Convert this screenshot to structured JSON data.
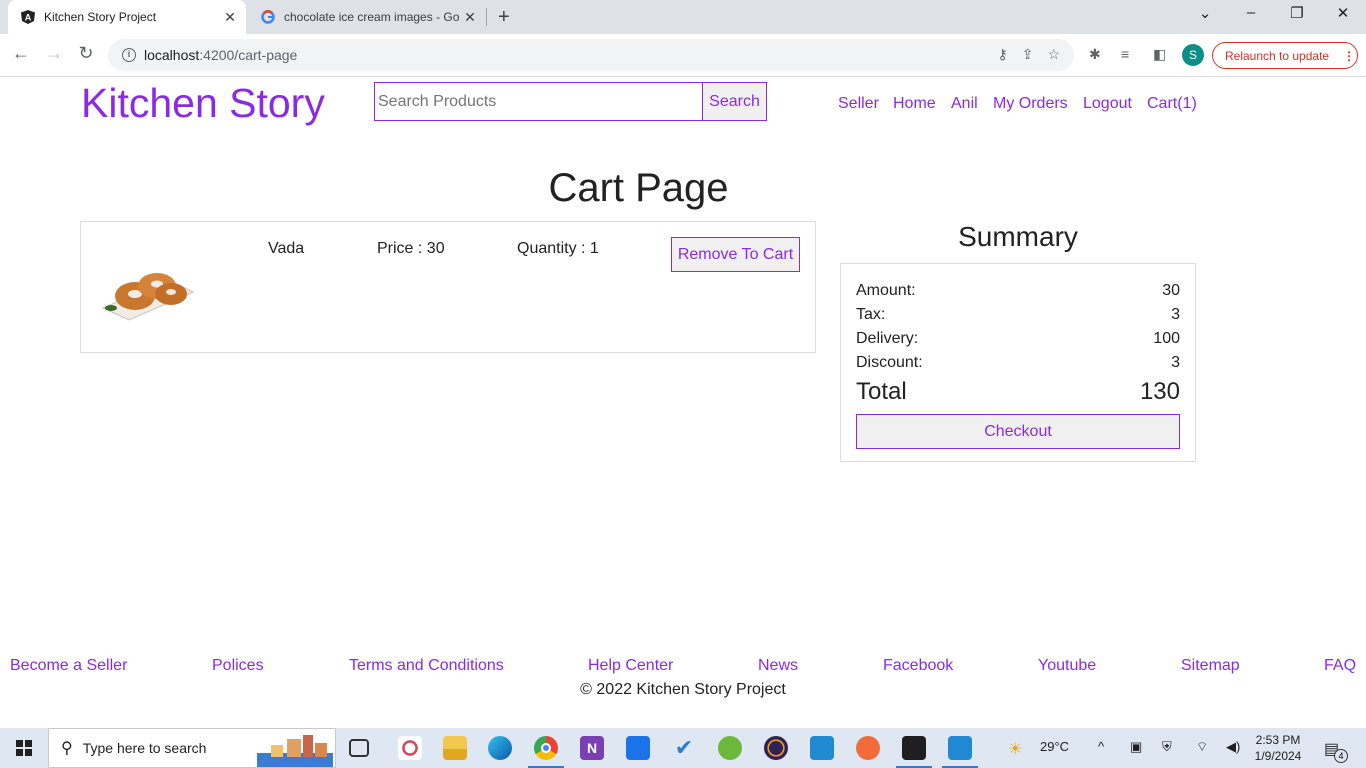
{
  "browser": {
    "tabs": [
      {
        "title": "Kitchen Story Project",
        "icon": "angular-icon"
      },
      {
        "title": "chocolate ice cream images - Go",
        "icon": "google-icon"
      }
    ],
    "url_host": "localhost",
    "url_path": ":4200/cart-page",
    "relaunch_label": "Relaunch to update",
    "profile_initial": "S"
  },
  "header": {
    "brand": "Kitchen Story",
    "search_placeholder": "Search Products",
    "search_label": "Search",
    "nav": [
      "Seller",
      "Home",
      "Anil",
      "My Orders",
      "Logout",
      "Cart(1)"
    ]
  },
  "cart": {
    "heading": "Cart Page",
    "item": {
      "name": "Vada",
      "price": "Price : 30",
      "quantity": "Quantity : 1",
      "remove_label": "Remove To Cart"
    }
  },
  "summary": {
    "heading": "Summary",
    "rows": [
      {
        "label": "Amount:",
        "value": "30"
      },
      {
        "label": "Tax:",
        "value": "3"
      },
      {
        "label": "Delivery:",
        "value": "100"
      },
      {
        "label": "Discount:",
        "value": "3"
      }
    ],
    "total_label": "Total",
    "total_value": "130",
    "checkout_label": "Checkout"
  },
  "footer": {
    "links": [
      "Become a Seller",
      "Polices",
      "Terms and Conditions",
      "Help Center",
      "News",
      "Facebook",
      "Youtube",
      "Sitemap",
      "FAQ"
    ],
    "copyright": "© 2022 Kitchen Story Project"
  },
  "taskbar": {
    "search_placeholder": "Type here to search",
    "weather": "29°C",
    "time": "2:53 PM",
    "date": "1/9/2024",
    "notifications": "4"
  },
  "colors": {
    "accent": "#8a2be2",
    "tab_bar": "#dee1e6",
    "relaunch": "#d93025",
    "taskbar": "#dfe7f2"
  }
}
